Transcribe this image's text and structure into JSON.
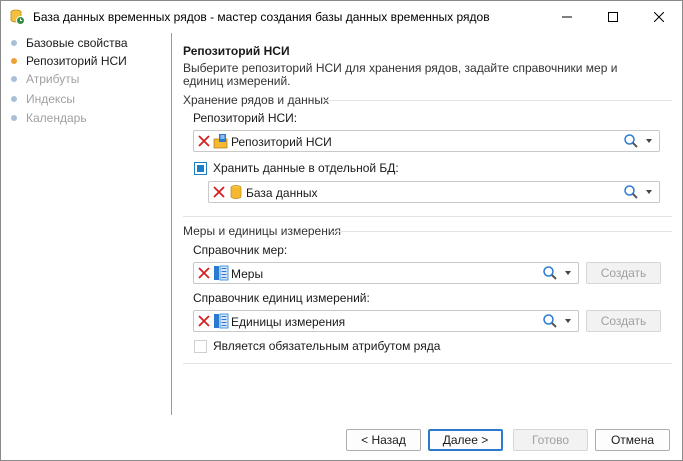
{
  "window": {
    "title": "База данных временных рядов - мастер создания базы данных временных рядов",
    "icons": {
      "app": "database-clock-icon",
      "minimize": "minimize-icon",
      "maximize": "maximize-icon",
      "close": "close-icon"
    }
  },
  "sidebar": {
    "items": [
      {
        "label": "Базовые свойства",
        "state": "done",
        "dot_color": "#a9bfd6"
      },
      {
        "label": "Репозиторий НСИ",
        "state": "current",
        "dot_color": "#f0a030"
      },
      {
        "label": "Атрибуты",
        "state": "pending",
        "dot_color": "#a9bfd6"
      },
      {
        "label": "Индексы",
        "state": "pending",
        "dot_color": "#a9bfd6"
      },
      {
        "label": "Календарь",
        "state": "pending",
        "dot_color": "#a9bfd6"
      }
    ]
  },
  "page": {
    "heading": "Репозиторий НСИ",
    "description": "Выберите репозиторий НСИ для хранения рядов, задайте справочники мер и единиц измерений."
  },
  "storage_group": {
    "label": "Хранение рядов и данных",
    "repository": {
      "label": "Репозиторий НСИ:",
      "value": "Репозиторий НСИ",
      "icon": "repository-icon"
    },
    "separate_db": {
      "label": "Хранить данные в отдельной БД:",
      "checked": true
    },
    "database": {
      "value": "База данных",
      "icon": "database-icon"
    }
  },
  "measures_group": {
    "label": "Меры и единицы измерения",
    "measures": {
      "label": "Справочник мер:",
      "value": "Меры",
      "icon": "dictionary-icon",
      "create_label": "Создать"
    },
    "units": {
      "label": "Справочник единиц измерений:",
      "value": "Единицы измерения",
      "icon": "dictionary-icon",
      "create_label": "Создать"
    },
    "required_attr": {
      "label": "Является обязательным атрибутом ряда",
      "checked": false
    }
  },
  "footer": {
    "back": "< Назад",
    "next": "Далее >",
    "finish": "Готово",
    "cancel": "Отмена"
  },
  "colors": {
    "accent": "#1f7fc4",
    "clear_x": "#d42020",
    "current_step": "#f0a030"
  }
}
